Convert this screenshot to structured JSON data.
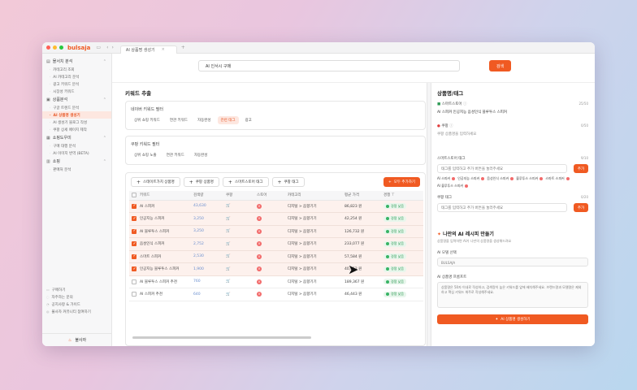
{
  "window": {
    "logo": "bulsaja",
    "tab_label": "AI 상품명 생성기"
  },
  "sidebar": {
    "sections": [
      {
        "label": "몰서치 분석",
        "items": [
          "카테고리 조회",
          "AI 카테고리 분석",
          "광고 키워드 분석",
          "시장성 키워드"
        ]
      },
      {
        "label": "상품분석",
        "items": [
          "구글 트렌드 분석",
          "AI 상품명 생성기",
          "AI 생성기 블로그 작성",
          "쿠팡 상세 페이지 제작"
        ]
      },
      {
        "label": "쇼핑도우미",
        "items": [
          "구매 대행 분석",
          "AI 이미지 번역 (BETA)"
        ]
      },
      {
        "label": "쇼핑",
        "items": [
          "판매처 분석"
        ]
      }
    ],
    "active_item": "AI 상품명 생성기",
    "footer": [
      "구매하기",
      "자주하는 문의",
      "공지사항 & 가이드",
      "불사자 커뮤니티 참여하기"
    ],
    "brand": "불사자"
  },
  "search": {
    "value": "AI 인서시 구매",
    "button": "검색"
  },
  "main": {
    "title": "키워드 추출",
    "box1": {
      "label": "네이버 키워드 필터",
      "chips": [
        "상위 쇼핑 키워드",
        "연관 키워드",
        "자동완성",
        "관련 태그",
        "광고"
      ],
      "active_chip": "관련 태그"
    },
    "box2": {
      "label": "쿠팡 키워드 필터",
      "chips": [
        "상위 쇼핑 노출",
        "연관 키워드",
        "자동완성"
      ]
    },
    "actions": [
      "스테이트가치 상품명",
      "쿠팡 상품명",
      "스마트스토어 태그",
      "쿠팡 태그"
    ],
    "add_keyword": "모두 추가하기",
    "columns": [
      "키워드",
      "검색량",
      "쿠팡",
      "스토어",
      "카테고리",
      "평균 가격",
      "경쟁"
    ],
    "rows": [
      {
        "checked": true,
        "keyword": "AI 스피커",
        "volume": "43,630",
        "price": "86,823 원",
        "badge": "경쟁 낮음"
      },
      {
        "checked": true,
        "keyword": "인공지능 스피커",
        "volume": "3,250",
        "price": "42,254 원",
        "badge": "경쟁 낮음"
      },
      {
        "checked": true,
        "keyword": "AI 블루투스 스피커",
        "volume": "3,250",
        "price": "126,732 원",
        "badge": "경쟁 낮음"
      },
      {
        "checked": true,
        "keyword": "음성인식 스피커",
        "volume": "2,752",
        "price": "233,077 원",
        "badge": "경쟁 낮음"
      },
      {
        "checked": true,
        "keyword": "스마트 스피커",
        "volume": "2,530",
        "price": "57,584 원",
        "badge": "경쟁 낮음"
      },
      {
        "checked": true,
        "keyword": "인공지능 블루투스 스피커",
        "volume": "1,900",
        "price": "40,652 원",
        "badge": "경쟁 낮음"
      },
      {
        "checked": false,
        "keyword": "AI 블루투스 스피커 추천",
        "volume": "760",
        "price": "189,367 원",
        "badge": "경쟁 낮음"
      },
      {
        "checked": false,
        "keyword": "AI 스피커 추천",
        "volume": "640",
        "price": "46,443 원",
        "badge": "경쟁 낮음"
      }
    ],
    "row_category": "디지털 > 음향기기"
  },
  "right": {
    "title": "상품명/태그",
    "smartstore_label": "스마트스토어",
    "smartstore_value": "AI 스피커 인공지능 음성인식 블루투스 스피커",
    "smartstore_count": "25/50",
    "coupang_label": "쿠팡",
    "coupang_value": "쿠팡 상품명을 입력하세요",
    "coupang_count": "0/50",
    "st_tag_label": "스마트스토어 태그",
    "st_tag_count": "9/10",
    "st_tag_placeholder": "태그를 입력하고 추가 버튼을 눌러주세요",
    "add": "추가",
    "tags": [
      "AI 스피커",
      "인공지능 스피커",
      "음성인식 스피커",
      "블루투스 스피커",
      "스마트 스피커",
      "AI 블루투스 스피커"
    ],
    "cp_tag_label": "쿠팡 태그",
    "cp_tag_count": "0/20",
    "cp_tag_placeholder": "태그를 입력하고 추가 버튼을 눌러주세요",
    "ai_title": "나만의 AI 레시피 만들기",
    "ai_desc": "상품명을 입력하면 AI가 나만의 상품명을 생성해드려요",
    "ai_model_label": "AI 모델 선택",
    "ai_model_value": "BULSAJA",
    "ai_prompt_label": "AI 상품명 프롬프트",
    "ai_prompt_value": "상품명은 50자 이내로 작성하고, 검색량이 높은 키워드를 앞에 배치해주세요. 브랜드명과 모델명은 제외하고 핵심 키워드 위주로 작성해주세요.",
    "ai_button": "AI 상품명 생성하기"
  },
  "colors": {
    "accent": "#f05a22",
    "active_bg": "#fde7e0",
    "badge_green": "#2e9a55"
  },
  "icons": {
    "coupang": "cart-icon",
    "store": "x-circle-icon",
    "filter": "filter-icon"
  }
}
